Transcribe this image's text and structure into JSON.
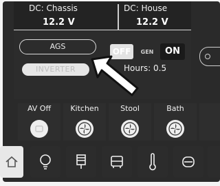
{
  "voltages": [
    {
      "label": "DC: Chassis",
      "value": "12.2 V"
    },
    {
      "label": "DC: House",
      "value": "12.2 V"
    }
  ],
  "generator": {
    "ags_label": "AGS",
    "inverter_label": "INVERTER",
    "toggle_off_label": "OFF",
    "toggle_gen_label": "GEN",
    "toggle_on_label": "ON",
    "hours_text": "Hours: 0.5",
    "state": "ON"
  },
  "lights": [
    {
      "label": "AV Off",
      "icon": "av-power-icon"
    },
    {
      "label": "Kitchen",
      "icon": "fan-icon"
    },
    {
      "label": "Stool",
      "icon": "fan-icon"
    },
    {
      "label": "Bath",
      "icon": "fan-icon"
    }
  ],
  "bottom_nav": [
    {
      "name": "home",
      "icon": "home-icon"
    },
    {
      "name": "lights",
      "icon": "lightbulb-icon"
    },
    {
      "name": "shades",
      "icon": "shade-icon"
    },
    {
      "name": "vehicle",
      "icon": "vehicle-icon"
    },
    {
      "name": "temperature",
      "icon": "thermometer-icon"
    },
    {
      "name": "tank",
      "icon": "tank-icon"
    }
  ],
  "colors": {
    "panel": "#2a2a2a",
    "text": "#f2f2f2",
    "active_toggle": "#1a1a1a",
    "inactive_toggle": "#e3e3e3"
  }
}
